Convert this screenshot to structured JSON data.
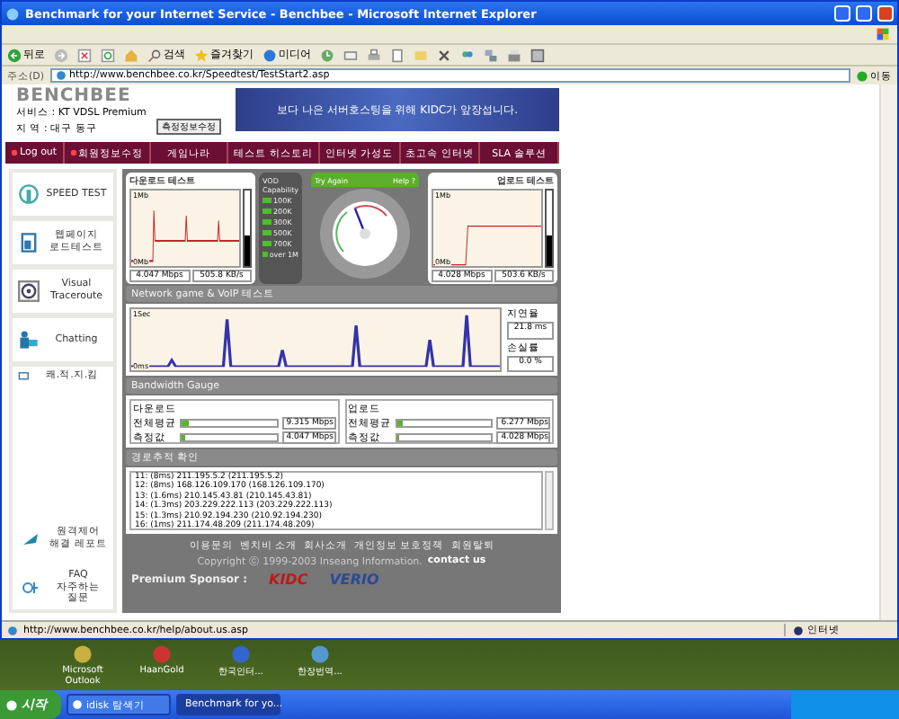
{
  "window": {
    "title": "Benchmark for your Internet Service - Benchbee - Microsoft Internet Explorer"
  },
  "toolbar": [
    {
      "kind": "back",
      "label": "뒤로"
    },
    {
      "kind": "forward"
    },
    {
      "kind": "stop"
    },
    {
      "kind": "refresh"
    },
    {
      "kind": "home"
    },
    {
      "kind": "search",
      "label": "검색"
    },
    {
      "kind": "favorites",
      "label": "즐겨찾기"
    },
    {
      "kind": "media",
      "label": "미디어"
    },
    {
      "kind": "history"
    },
    {
      "kind": "mail"
    },
    {
      "kind": "print"
    },
    {
      "kind": "edit"
    },
    {
      "kind": "folder"
    },
    {
      "kind": "tools"
    },
    {
      "kind": "messenger"
    },
    {
      "kind": "network"
    },
    {
      "kind": "printer"
    },
    {
      "kind": "calculator"
    }
  ],
  "address": {
    "label": "주소(D)",
    "url": "http://www.benchbee.co.kr/Speedtest/TestStart2.asp",
    "go": "이동"
  },
  "header": {
    "logo": "BENCHBEE",
    "service": "서비스 : KT VDSL Premium",
    "region": "지 역 : 대구 동구",
    "edit_button": "측정정보수정",
    "banner": "보다 나은 서버호스팅을 위해 KIDC가 앞장섭니다."
  },
  "nav": [
    {
      "label": "Log out",
      "kind": "bullet"
    },
    {
      "label": "회원정보수정",
      "kind": "bullet"
    },
    {
      "label": "게임나라",
      "kind": "plain"
    },
    {
      "label": "테스트 히스토리",
      "kind": "plain"
    },
    {
      "label": "인터넷 가성도",
      "kind": "plain"
    },
    {
      "label": "초고속 인터넷",
      "kind": "plain"
    },
    {
      "label": "SLA 솔루션",
      "kind": "plain"
    }
  ],
  "sidebar": [
    {
      "label": "SPEED TEST",
      "kind": "speed"
    },
    {
      "label": "웹페이지 로드테스트",
      "kind": "web"
    },
    {
      "label": "Visual Traceroute",
      "kind": "trace"
    },
    {
      "label": "Chatting",
      "kind": "chat"
    },
    {
      "label": "쾌.적.지.킴",
      "kind": "small"
    },
    {
      "label": "원격제어 해결 레포트",
      "kind": "report"
    },
    {
      "label": "FAQ 자주하는 질문",
      "kind": "faq"
    }
  ],
  "download": {
    "title": "다운로드 테스트",
    "graph_top": "1Mb",
    "graph_bottom": "0Mb",
    "level": 0.4,
    "mbps": "4.047 Mbps",
    "kbs": "505.8 KB/s"
  },
  "vod": {
    "title": "VOD Capability",
    "rates": [
      {
        "label": "100K",
        "on": true
      },
      {
        "label": "200K",
        "on": true
      },
      {
        "label": "300K",
        "on": true
      },
      {
        "label": "500K",
        "on": true
      },
      {
        "label": "700K",
        "on": true
      },
      {
        "label": "over 1M",
        "on": true
      }
    ]
  },
  "gauge": {
    "try_again": "Try Again",
    "help": "Help",
    "help_mark": "?",
    "level": 0.42
  },
  "upload": {
    "title": "업로드 테스트",
    "graph_top": "1Mb",
    "graph_bottom": "0Mb",
    "level": 0.4,
    "mbps": "4.028 Mbps",
    "kbs": "503.6 KB/s"
  },
  "voip": {
    "title": "Network game & VoIP 테스트",
    "graph_top": "1Sec",
    "graph_bottom": "0ms",
    "delay_label": "지연율",
    "delay": "21.8 ms",
    "loss_label": "손실률",
    "loss": "0.0 %"
  },
  "bandwidth": {
    "title": "Bandwidth Gauge",
    "groups": [
      {
        "title": "다운로드",
        "rows": [
          {
            "label": "전체평균",
            "level": 0.08,
            "value": "9.315 Mbps"
          },
          {
            "label": "측정값",
            "level": 0.03,
            "value": "4.047 Mbps"
          }
        ]
      },
      {
        "title": "업로드",
        "rows": [
          {
            "label": "전체평균",
            "level": 0.06,
            "value": "6.277 Mbps"
          },
          {
            "label": "측정값",
            "level": 0.03,
            "value": "4.028 Mbps"
          }
        ]
      }
    ]
  },
  "trace": {
    "title": "경로추적 확인",
    "lines": [
      "11: (8ms) 211.195.5.2 (211.195.5.2)",
      "12: (8ms) 168.126.109.170 (168.126.109.170)",
      "13: (1.6ms) 210.145.43.81 (210.145.43.81)",
      "14: (1.3ms) 203.229.222.113 (203.229.222.113)",
      "15: (1.3ms) 210.92.194.230 (210.92.194.230)",
      "16: (1ms) 211.174.48.209 (211.174.48.209)"
    ]
  },
  "footer": {
    "links": [
      "이용문의",
      "벤치비 소개",
      "회사소개",
      "개인정보 보호정책",
      "회원탈퇴"
    ],
    "copyright": "Copyright ⓒ 1999-2003 Inseang Information.",
    "contact": "contact us",
    "sponsor_label": "Premium Sponsor :",
    "sponsors": [
      "KIDC",
      "VERIO"
    ]
  },
  "status_bar": {
    "url": "http://www.benchbee.co.kr/help/about.us.asp",
    "zone": "인터넷"
  },
  "desktop": {
    "icons": [
      {
        "label": "Microsoft Outlook",
        "kind": "outlook"
      },
      {
        "label": "HaanGold",
        "kind": "haan"
      },
      {
        "label": "한국인터...",
        "kind": "ie"
      },
      {
        "label": "한장번역...",
        "kind": "app"
      }
    ]
  },
  "taskbar": {
    "start": "시작",
    "tasks": [
      {
        "label": "idisk 탐색기",
        "selected": false
      },
      {
        "label": "Benchmark for yo...",
        "selected": true
      }
    ]
  }
}
